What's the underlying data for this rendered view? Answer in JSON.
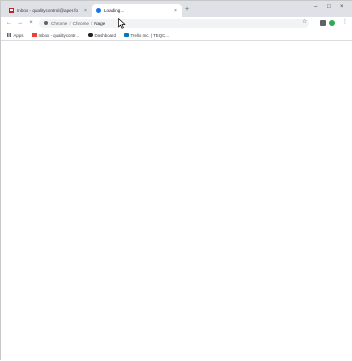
{
  "tabs": [
    {
      "title": "Inbox - qualitycontrol@aper.fo",
      "favicon": "gmail-icon",
      "state": "inactive"
    },
    {
      "title": "Loading...",
      "favicon": "globe-icon",
      "state": "active"
    }
  ],
  "toolbar": {
    "address_crumbs": [
      "Chrome",
      "Chrome",
      "Nage"
    ],
    "reload_state": "stop"
  },
  "bookmarks": [
    {
      "label": "Apps",
      "icon": "apps-icon"
    },
    {
      "label": "Inbox - qualitycontr...",
      "icon": "gmail-icon"
    },
    {
      "label": "Dashboard",
      "icon": "dashboard-icon"
    },
    {
      "label": "Trello Inc. | TEQC...",
      "icon": "trello-icon"
    }
  ],
  "colors": {
    "tabstrip": "#dee1e6",
    "omnibox": "#f1f3f4",
    "accent": "#1a73e8"
  }
}
